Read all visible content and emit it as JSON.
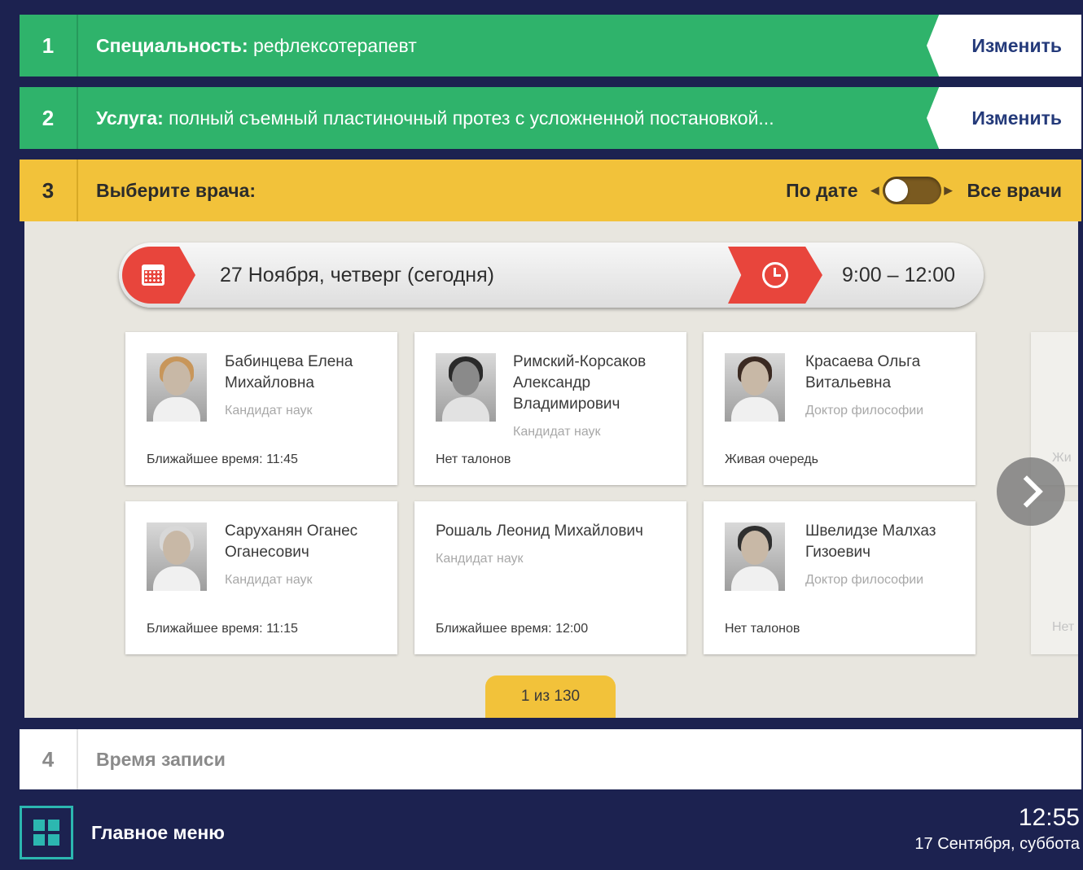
{
  "step1": {
    "num": "1",
    "label": "Специальность:",
    "value": " рефлексотерапевт",
    "button": "Изменить"
  },
  "step2": {
    "num": "2",
    "label": "Услуга:",
    "value": " полный съемный пластиночный протез с усложненной постановкой...",
    "button": "Изменить"
  },
  "step3": {
    "num": "3",
    "label": "Выберите врача:",
    "toggle_left": "По дате",
    "toggle_right": "Все врачи"
  },
  "datebar": {
    "date": "27 Ноября, четверг (сегодня)",
    "time": "9:00 – 12:00"
  },
  "doctors": [
    {
      "name": "Бабинцева Елена Михайловна",
      "degree": "Кандидат наук",
      "status": "Ближайшее время: 11:45"
    },
    {
      "name": "Римский-Корсаков Александр Владимирович",
      "degree": "Кандидат наук",
      "status": "Нет талонов"
    },
    {
      "name": "Красаева Ольга Витальевна",
      "degree": "Доктор философии",
      "status": "Живая очередь"
    },
    {
      "name": "Саруханян Оганес Оганесович",
      "degree": "Кандидат наук",
      "status": "Ближайшее время: 11:15"
    },
    {
      "name": "Рошаль Леонид Михайлович",
      "degree": "Кандидат наук",
      "status": "Ближайшее время: 12:00"
    },
    {
      "name": "Швелидзе Малхаз Гизоевич",
      "degree": "Доктор философии",
      "status": "Нет талонов"
    }
  ],
  "partial_cards": [
    {
      "status": "Жи"
    },
    {
      "status": "Нет"
    }
  ],
  "pager": "1 из 130",
  "step4": {
    "num": "4",
    "label": "Время записи"
  },
  "footer": {
    "menu": "Главное меню",
    "time": "12:55",
    "date": "17 Сентября, суббота"
  },
  "colors": {
    "green": "#2fb36b",
    "yellow": "#f2c23a",
    "red": "#e8453c",
    "navy": "#1c2250",
    "teal": "#2cb7b0"
  }
}
